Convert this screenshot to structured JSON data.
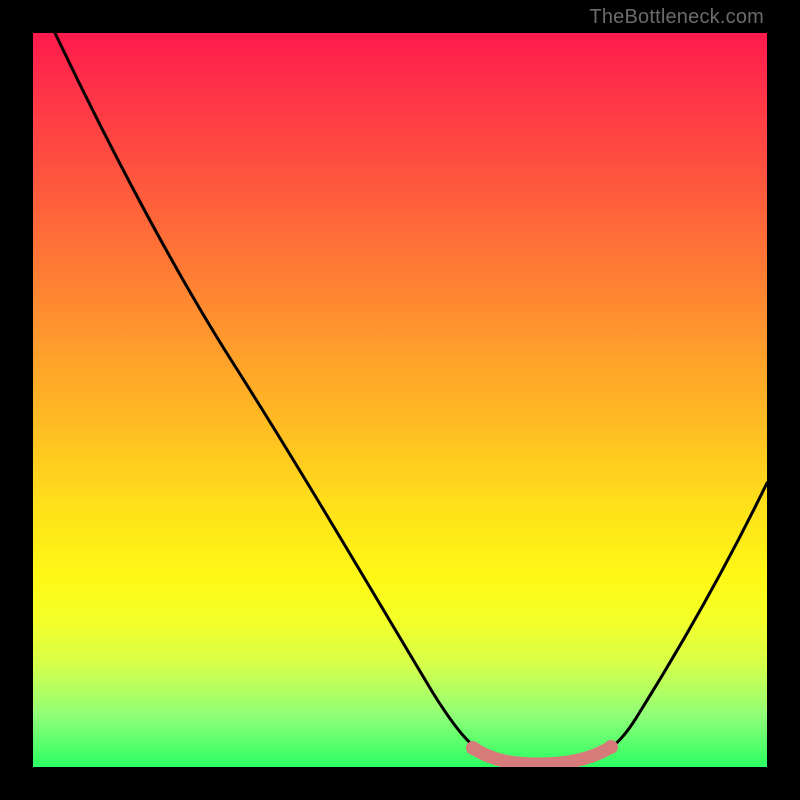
{
  "attribution": "TheBottleneck.com",
  "chart_data": {
    "type": "line",
    "title": "",
    "xlabel": "",
    "ylabel": "",
    "xlim": [
      0,
      100
    ],
    "ylim": [
      0,
      100
    ],
    "series": [
      {
        "name": "bottleneck-curve",
        "x": [
          3,
          10,
          20,
          30,
          40,
          50,
          55,
          58,
          62,
          66,
          70,
          74,
          78,
          80,
          85,
          90,
          95,
          100
        ],
        "y": [
          100,
          88,
          72,
          56,
          40,
          24,
          15,
          8,
          3,
          1,
          0.5,
          0.5,
          1,
          3,
          11,
          22,
          35,
          48
        ]
      },
      {
        "name": "highlight-band",
        "x": [
          60,
          63,
          66,
          70,
          74,
          77,
          80
        ],
        "y": [
          3.5,
          1.5,
          0.8,
          0.5,
          0.8,
          1.5,
          3.5
        ]
      }
    ],
    "colors": {
      "curve": "#000000",
      "highlight": "#d77a7a",
      "gradient_top": "#ff1a4d",
      "gradient_bottom": "#2bff62"
    }
  }
}
